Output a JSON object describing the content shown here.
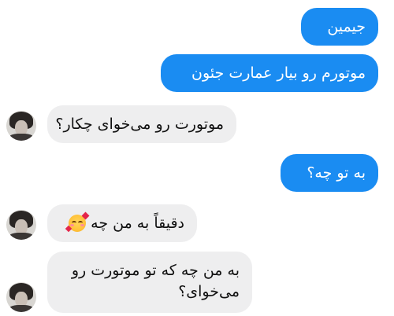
{
  "messages": [
    {
      "side": "out",
      "text": "جیمین"
    },
    {
      "side": "out",
      "text": "موتورم رو بیار عمارت جئون"
    },
    {
      "side": "in",
      "text": "موتورت رو می‌خوای چکار؟"
    },
    {
      "side": "out",
      "text": "به تو چه؟"
    },
    {
      "side": "in",
      "text": "دقیقاً به من چه",
      "emoji": "smiling-face-with-hearts-icon"
    },
    {
      "side": "in",
      "text": "به من چه که تو موتورت رو می‌خوای؟"
    }
  ],
  "colors": {
    "outgoing_bubble": "#1a8cf2",
    "incoming_bubble": "#eeeeef",
    "outgoing_text": "#ffffff",
    "incoming_text": "#111111"
  }
}
